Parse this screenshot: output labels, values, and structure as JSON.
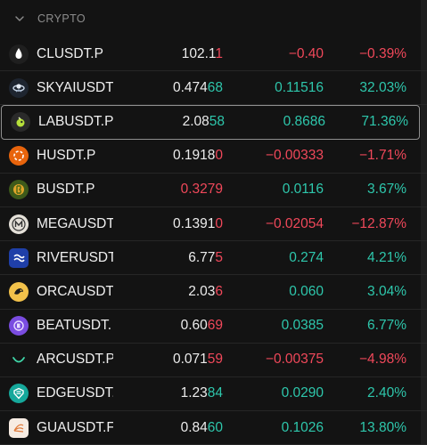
{
  "section": {
    "title": "CRYPTO"
  },
  "colors": {
    "positive": "#2ec7ac",
    "negative": "#f0485a",
    "background": "#131313"
  },
  "rows": [
    {
      "symbol": "CLUSDT.P",
      "icon": "droplet-icon",
      "last_head": "102.1",
      "last_tail": "1",
      "last_tail_dir": "down",
      "last_red": false,
      "change": "−0.40",
      "change_pct": "−0.39%",
      "dir": "neg"
    },
    {
      "symbol": "SKYAIUSDT.",
      "icon": "sky-ai-icon",
      "last_head": "0.474",
      "last_tail": "68",
      "last_tail_dir": "up",
      "last_red": false,
      "change": "0.11516",
      "change_pct": "32.03%",
      "dir": "pos"
    },
    {
      "symbol": "LABUSDT.P",
      "icon": "lab-icon",
      "last_head": "2.08",
      "last_tail": "58",
      "last_tail_dir": "up",
      "last_red": false,
      "change": "0.8686",
      "change_pct": "71.36%",
      "dir": "pos"
    },
    {
      "symbol": "HUSDT.P",
      "icon": "h-token-icon",
      "last_head": "0.1918",
      "last_tail": "0",
      "last_tail_dir": "down",
      "last_red": false,
      "change": "−0.00333",
      "change_pct": "−1.71%",
      "dir": "neg"
    },
    {
      "symbol": "BUSDT.P",
      "icon": "b-token-icon",
      "last_head": "0.3279",
      "last_tail": "",
      "last_tail_dir": "down",
      "last_red": true,
      "change": "0.0116",
      "change_pct": "3.67%",
      "dir": "pos"
    },
    {
      "symbol": "MEGAUSDT",
      "icon": "mega-icon",
      "last_head": "0.1391",
      "last_tail": "0",
      "last_tail_dir": "down",
      "last_red": false,
      "change": "−0.02054",
      "change_pct": "−12.87%",
      "dir": "neg"
    },
    {
      "symbol": "RIVERUSDT",
      "icon": "river-icon",
      "last_head": "6.77",
      "last_tail": "5",
      "last_tail_dir": "down",
      "last_red": false,
      "change": "0.274",
      "change_pct": "4.21%",
      "dir": "pos"
    },
    {
      "symbol": "ORCAUSDT.",
      "icon": "orca-icon",
      "last_head": "2.03",
      "last_tail": "6",
      "last_tail_dir": "down",
      "last_red": false,
      "change": "0.060",
      "change_pct": "3.04%",
      "dir": "pos"
    },
    {
      "symbol": "BEATUSDT.",
      "icon": "beat-icon",
      "last_head": "0.60",
      "last_tail": "69",
      "last_tail_dir": "down",
      "last_red": false,
      "change": "0.0385",
      "change_pct": "6.77%",
      "dir": "pos"
    },
    {
      "symbol": "ARCUSDT.P",
      "icon": "arc-icon",
      "last_head": "0.071",
      "last_tail": "59",
      "last_tail_dir": "down",
      "last_red": false,
      "change": "−0.00375",
      "change_pct": "−4.98%",
      "dir": "neg"
    },
    {
      "symbol": "EDGEUSDT.",
      "icon": "edge-icon",
      "last_head": "1.23",
      "last_tail": "84",
      "last_tail_dir": "up",
      "last_red": false,
      "change": "0.0290",
      "change_pct": "2.40%",
      "dir": "pos"
    },
    {
      "symbol": "GUAUSDT.F",
      "icon": "gua-icon",
      "last_head": "0.84",
      "last_tail": "60",
      "last_tail_dir": "up",
      "last_red": false,
      "change": "0.1026",
      "change_pct": "13.80%",
      "dir": "pos"
    }
  ]
}
